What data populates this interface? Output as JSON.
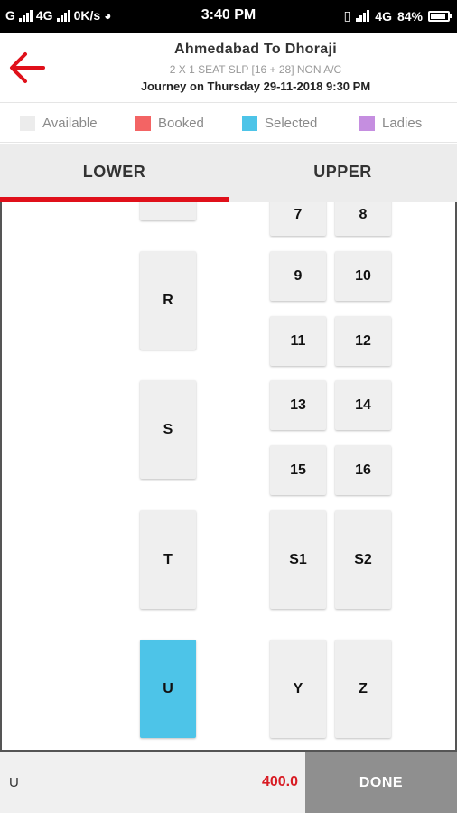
{
  "status_bar": {
    "left_text": "G",
    "net_left": "4G",
    "speed": "0K/s",
    "time": "3:40 PM",
    "net_right": "4G",
    "battery": "84%"
  },
  "header": {
    "route": "Ahmedabad To Dhoraji",
    "bus_type": "2 X 1 SEAT SLP [16 + 28] NON A/C",
    "journey": "Journey on Thursday 29-11-2018  9:30 PM"
  },
  "legend": [
    {
      "label": "Available",
      "color": "#ececec"
    },
    {
      "label": "Booked",
      "color": "#f36464"
    },
    {
      "label": "Selected",
      "color": "#4dc4e8"
    },
    {
      "label": "Ladies",
      "color": "#c58ee0"
    }
  ],
  "tabs": {
    "lower": "LOWER",
    "upper": "UPPER",
    "active": "LOWER"
  },
  "seats": {
    "s7": "7",
    "s8": "8",
    "s9": "9",
    "s10": "10",
    "s11": "11",
    "s12": "12",
    "s13": "13",
    "s14": "14",
    "s15": "15",
    "s16": "16",
    "sS1": "S1",
    "sS2": "S2",
    "sY": "Y",
    "sZ": "Z",
    "sR": "R",
    "sS": "S",
    "sT": "T",
    "sU": "U"
  },
  "selected_seat": "U",
  "bottom_bar": {
    "selected_seats": "U",
    "price": "400.0",
    "done_label": "DONE"
  }
}
